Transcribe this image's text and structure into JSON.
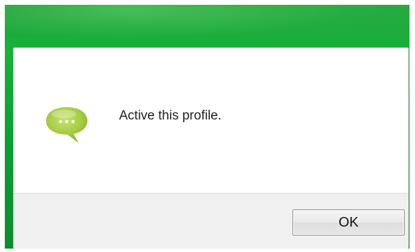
{
  "dialog": {
    "icon": "speech-bubble-icon",
    "message": "Active this profile.",
    "ok_label": "OK"
  },
  "colors": {
    "window_green": "#0aa033",
    "bubble_green": "#9fc93c",
    "footer_bg": "#f0f0f0"
  }
}
